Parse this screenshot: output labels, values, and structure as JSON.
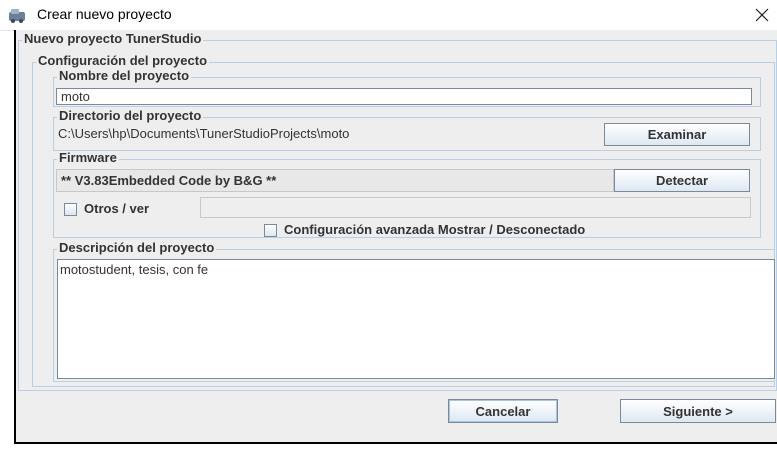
{
  "window": {
    "title": "Crear nuevo proyecto",
    "close_glyph": "✕",
    "icon": "tunerstudio-app-icon"
  },
  "outer_group": {
    "legend": "Nuevo proyecto TunerStudio"
  },
  "config_group": {
    "legend": "Configuración del proyecto"
  },
  "project_name": {
    "legend": "Nombre del proyecto",
    "value": "moto"
  },
  "project_dir": {
    "legend": "Directorio del proyecto",
    "path": "C:\\Users\\hp\\Documents\\TunerStudioProjects\\moto",
    "browse_label": "Examinar"
  },
  "firmware": {
    "legend": "Firmware",
    "value": "** V3.83Embedded Code by B&G **",
    "detect_label": "Detectar",
    "other_checkbox_label": "Otros / ver",
    "other_checked": false,
    "other_value": "",
    "advanced_checkbox_label": "Configuración avanzada Mostrar / Desconectado",
    "advanced_checked": false
  },
  "description": {
    "legend": "Descripción del proyecto",
    "value": "motostudent, tesis, con fe"
  },
  "footer": {
    "cancel_label": "Cancelar",
    "next_label": "Siguiente >"
  }
}
